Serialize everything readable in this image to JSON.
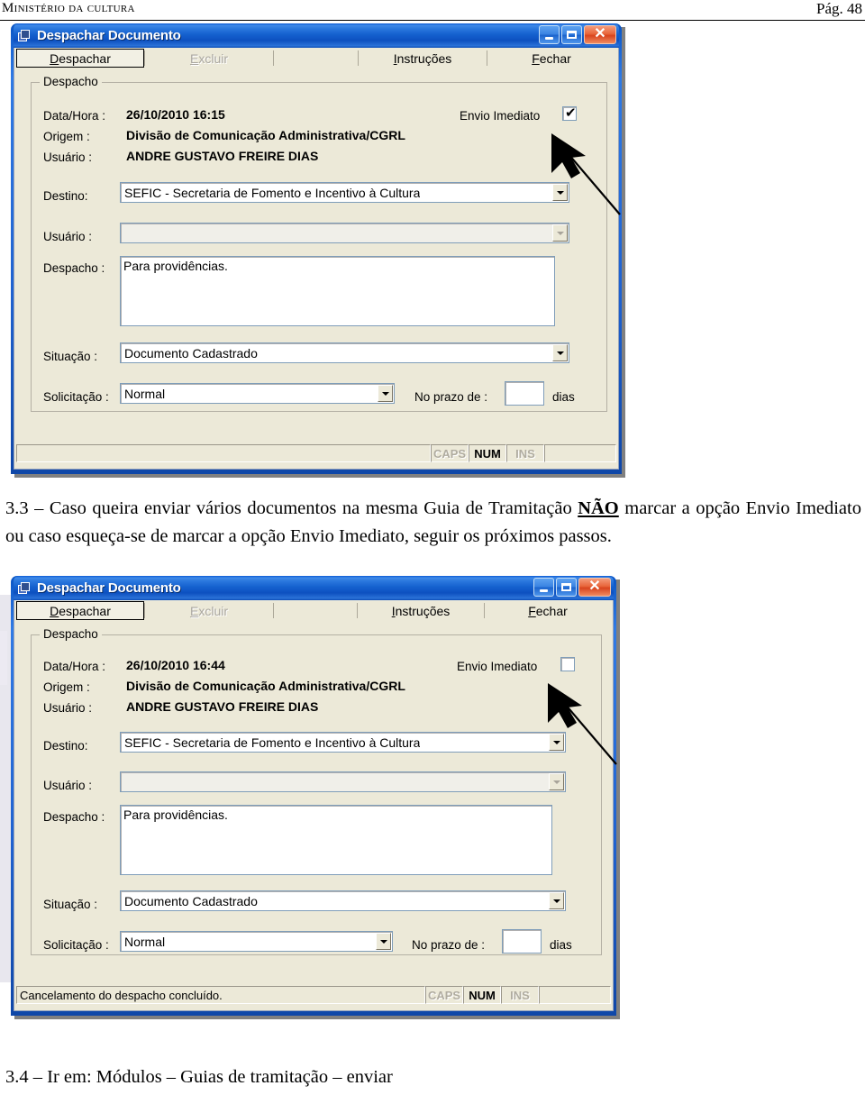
{
  "page": {
    "header_left": "Ministério da cultura",
    "header_right": "Pág. 48"
  },
  "paragraphs": {
    "step_33_num": "3.3 – Caso queira enviar vários documentos na mesma Guia de Tramitação ",
    "step_33_strong": "NÃO",
    "step_33_rest": " marcar a opção Envio Imediato ou caso esqueça-se de marcar a opção Envio Imediato, seguir os próximos passos.",
    "step_34": "3.4 – Ir em: Módulos – Guias de tramitação – enviar"
  },
  "window1": {
    "title": "Despachar Documento",
    "titlebar_buttons": {
      "minimize": "minimize-icon",
      "maximize": "maximize-icon",
      "close": "close-icon"
    },
    "toolbar": [
      {
        "label": "Despachar",
        "accel": "D",
        "state": "active"
      },
      {
        "label": "Excluir",
        "accel": "E",
        "state": "disabled"
      },
      {
        "label": "",
        "accel": "",
        "state": "blank"
      },
      {
        "label": "Instruções",
        "accel": "I",
        "state": "normal"
      },
      {
        "label": "Fechar",
        "accel": "F",
        "state": "normal"
      }
    ],
    "groupbox_legend": "Despacho",
    "fields": {
      "datahora_label": "Data/Hora :",
      "datahora_value": "26/10/2010 16:15",
      "origem_label": "Origem :",
      "origem_value": "Divisão de Comunicação Administrativa/CGRL",
      "usuario_top_label": "Usuário :",
      "usuario_top_value": "ANDRE GUSTAVO FREIRE DIAS",
      "envio_imediato_label": "Envio Imediato",
      "envio_imediato_checked": true,
      "destino_label": "Destino:",
      "destino_value": "SEFIC - Secretaria de Fomento e Incentivo à Cultura",
      "usuario_label": "Usuário :",
      "usuario_value": "",
      "despacho_label": "Despacho :",
      "despacho_value": "Para providências.",
      "situacao_label": "Situação :",
      "situacao_value": "Documento Cadastrado",
      "solicitacao_label": "Solicitação :",
      "solicitacao_value": "Normal",
      "prazo_label": "No prazo de :",
      "prazo_value": "",
      "prazo_unit": "dias"
    },
    "statusbar": {
      "message": "",
      "caps": "CAPS",
      "num": "NUM",
      "ins": "INS"
    }
  },
  "window2": {
    "title": "Despachar Documento",
    "toolbar": [
      {
        "label": "Despachar",
        "accel": "D",
        "state": "active"
      },
      {
        "label": "Excluir",
        "accel": "E",
        "state": "disabled"
      },
      {
        "label": "",
        "accel": "",
        "state": "blank"
      },
      {
        "label": "Instruções",
        "accel": "I",
        "state": "normal"
      },
      {
        "label": "Fechar",
        "accel": "F",
        "state": "normal"
      }
    ],
    "groupbox_legend": "Despacho",
    "fields": {
      "datahora_label": "Data/Hora :",
      "datahora_value": "26/10/2010 16:44",
      "origem_label": "Origem :",
      "origem_value": "Divisão de Comunicação Administrativa/CGRL",
      "usuario_top_label": "Usuário :",
      "usuario_top_value": "ANDRE GUSTAVO FREIRE DIAS",
      "envio_imediato_label": "Envio Imediato",
      "envio_imediato_checked": false,
      "destino_label": "Destino:",
      "destino_value": "SEFIC - Secretaria de Fomento e Incentivo à Cultura",
      "usuario_label": "Usuário :",
      "usuario_value": "",
      "despacho_label": "Despacho :",
      "despacho_value": "Para providências.",
      "situacao_label": "Situação :",
      "situacao_value": "Documento Cadastrado",
      "solicitacao_label": "Solicitação :",
      "solicitacao_value": "Normal",
      "prazo_label": "No prazo de :",
      "prazo_value": "",
      "prazo_unit": "dias"
    },
    "statusbar": {
      "message": "Cancelamento do despacho concluído.",
      "caps": "CAPS",
      "num": "NUM",
      "ins": "INS"
    }
  },
  "colors": {
    "titlebar_blue": "#0b55c4",
    "close_red": "#d8441e",
    "dialog_face": "#ece9d8",
    "field_white": "#ffffff"
  }
}
